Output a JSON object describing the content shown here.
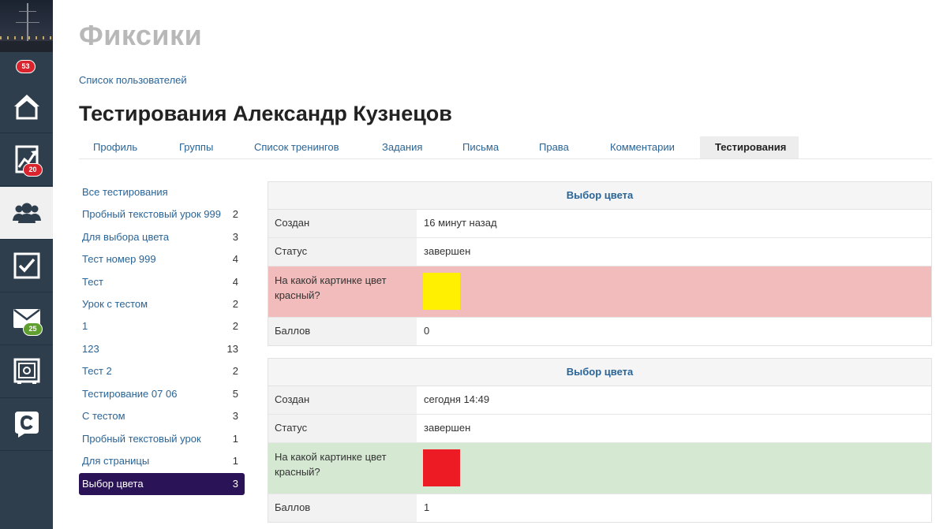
{
  "sidebar": {
    "badges": {
      "top": "53",
      "stats": "20",
      "mail": "25"
    }
  },
  "app": {
    "title": "Фиксики"
  },
  "breadcrumb": {
    "label": "Список пользователей"
  },
  "page": {
    "title": "Тестирования Александр Кузнецов"
  },
  "tabs": [
    {
      "label": "Профиль"
    },
    {
      "label": "Группы"
    },
    {
      "label": "Список тренингов"
    },
    {
      "label": "Задания"
    },
    {
      "label": "Письма"
    },
    {
      "label": "Права"
    },
    {
      "label": "Комментарии"
    },
    {
      "label": "Тестирования",
      "active": true
    }
  ],
  "tests": [
    {
      "label": "Все тестирования",
      "count": ""
    },
    {
      "label": "Пробный текстовый урок 999",
      "count": "2"
    },
    {
      "label": "Для выбора цвета",
      "count": "3"
    },
    {
      "label": "Тест номер 999",
      "count": "4"
    },
    {
      "label": "Тест",
      "count": "4"
    },
    {
      "label": "Урок с тестом",
      "count": "2"
    },
    {
      "label": "1",
      "count": "2"
    },
    {
      "label": "123",
      "count": "13"
    },
    {
      "label": "Тест 2",
      "count": "2"
    },
    {
      "label": "Тестирование 07 06",
      "count": "5"
    },
    {
      "label": "С тестом",
      "count": "3"
    },
    {
      "label": "Пробный текстовый урок",
      "count": "1"
    },
    {
      "label": "Для страницы",
      "count": "1"
    },
    {
      "label": "Выбор цвета",
      "count": "3",
      "active": true
    }
  ],
  "results": [
    {
      "title": "Выбор цвета",
      "created_label": "Создан",
      "created": "16 минут назад",
      "status_label": "Статус",
      "status": "завершен",
      "question": "На какой картинке цвет красный?",
      "answer_color": "#ffef00",
      "row_color": "#f2bcbc",
      "score_label": "Баллов",
      "score": "0"
    },
    {
      "title": "Выбор цвета",
      "created_label": "Создан",
      "created": "сегодня 14:49",
      "status_label": "Статус",
      "status": "завершен",
      "question": "На какой картинке цвет красный?",
      "answer_color": "#ed1c24",
      "row_color": "#d4e8d2",
      "score_label": "Баллов",
      "score": "1"
    }
  ],
  "colors": {
    "sidebar_bg": "#2f3e4c",
    "link": "#2a6496",
    "active_item": "#2b1357",
    "badge_red": "#d9232d",
    "badge_green": "#5f9e2f"
  }
}
